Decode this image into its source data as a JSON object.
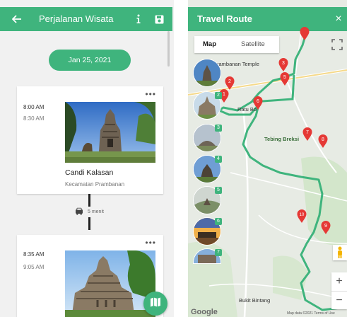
{
  "itinerary": {
    "title": "Perjalanan Wisata",
    "date": "Jan 25, 2021",
    "stops": [
      {
        "start": "8:00 AM",
        "end": "8:30 AM",
        "name": "Candi Kalasan",
        "location": "Kecamatan Prambanan"
      },
      {
        "start": "8:35 AM",
        "end": "9:05 AM",
        "name": "",
        "location": ""
      }
    ],
    "travel_time": "5 menit",
    "more_label": "•••"
  },
  "map": {
    "title": "Travel Route",
    "close": "×",
    "types": [
      "Map",
      "Satellite"
    ],
    "labels": {
      "prambanan": "Prambanan Temple",
      "ratu": "Ratu Bo",
      "tebing": "Tebing Breksi",
      "bukit": "Bukit Bintang"
    },
    "markers": [
      "1",
      "2",
      "3",
      "4",
      "5",
      "6",
      "7",
      "8",
      "9",
      "10",
      "11"
    ],
    "thumb_badges": [
      "2",
      "3",
      "4",
      "5",
      "6",
      "7"
    ],
    "zoom_in": "+",
    "zoom_out": "−",
    "google": "Google",
    "footer": "Map data ©2021  Terms of Use"
  },
  "colors": {
    "accent": "#3fb47d",
    "route": "#3fb47d",
    "marker": "#e53935"
  }
}
